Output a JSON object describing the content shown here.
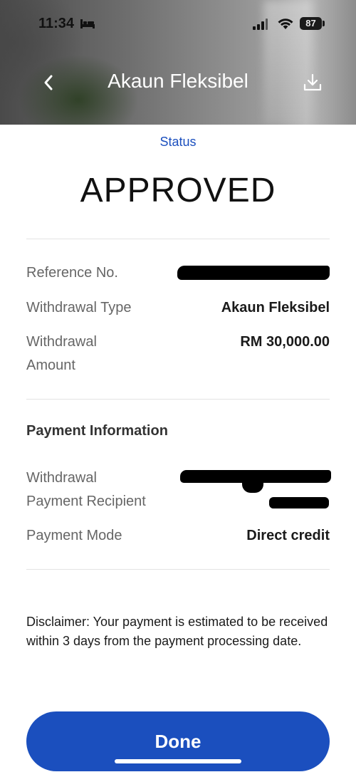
{
  "status_bar": {
    "time": "11:34",
    "battery": "87"
  },
  "nav": {
    "title": "Akaun Fleksibel"
  },
  "status": {
    "label": "Status",
    "value": "APPROVED"
  },
  "details": {
    "reference_label": "Reference No.",
    "withdrawal_type_label": "Withdrawal Type",
    "withdrawal_type_value": "Akaun Fleksibel",
    "amount_label_line1": "Withdrawal",
    "amount_label_line2": "Amount",
    "amount_value": "RM 30,000.00"
  },
  "payment": {
    "section_title": "Payment Information",
    "recipient_label_line1": "Withdrawal",
    "recipient_label_line2": "Payment Recipient",
    "mode_label": "Payment Mode",
    "mode_value": "Direct credit"
  },
  "disclaimer": "Disclaimer: Your payment is estimated to be received within 3 days from the payment processing date.",
  "done_label": "Done",
  "colors": {
    "accent": "#1b4fbe"
  }
}
